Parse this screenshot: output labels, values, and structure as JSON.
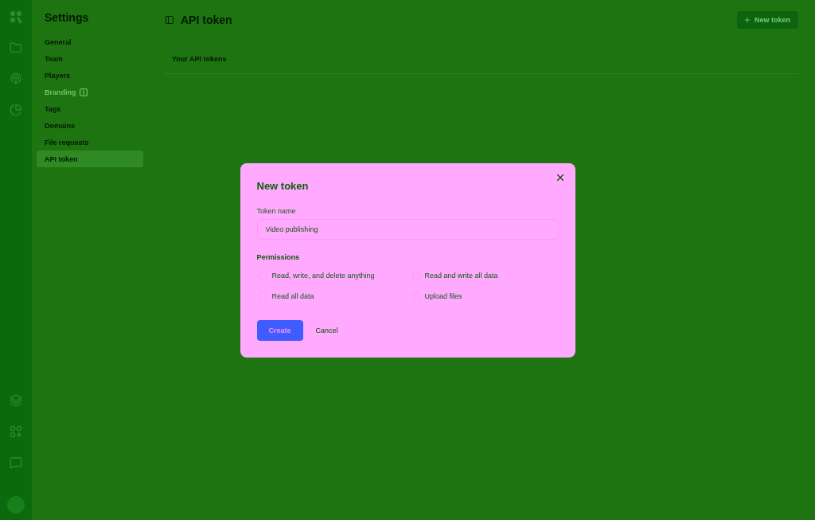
{
  "sidebar": {
    "title": "Settings",
    "items": [
      {
        "label": "General",
        "selected": false,
        "kind": "page"
      },
      {
        "label": "Team",
        "selected": false,
        "kind": "page"
      },
      {
        "label": "Players",
        "selected": false,
        "kind": "page"
      },
      {
        "label": "Branding",
        "selected": false,
        "kind": "locked"
      },
      {
        "label": "Tags",
        "selected": false,
        "kind": "page"
      },
      {
        "label": "Domains",
        "selected": false,
        "kind": "page"
      },
      {
        "label": "File requests",
        "selected": false,
        "kind": "page"
      },
      {
        "label": "API token",
        "selected": true,
        "kind": "page"
      }
    ]
  },
  "header": {
    "title": "API token",
    "new_button": "New token"
  },
  "tokens_section": {
    "heading": "Your API tokens"
  },
  "dialog": {
    "title": "New token",
    "name_field": {
      "label": "Token name",
      "value": "Video publishing"
    },
    "permissions": {
      "label": "Permissions",
      "options": [
        {
          "label": "Read, write, and delete anything",
          "checked": false
        },
        {
          "label": "Read and write all data",
          "checked": false
        },
        {
          "label": "Read all data",
          "checked": false
        },
        {
          "label": "Upload files",
          "checked": false
        }
      ]
    },
    "buttons": {
      "primary": "Create",
      "secondary": "Cancel"
    }
  }
}
